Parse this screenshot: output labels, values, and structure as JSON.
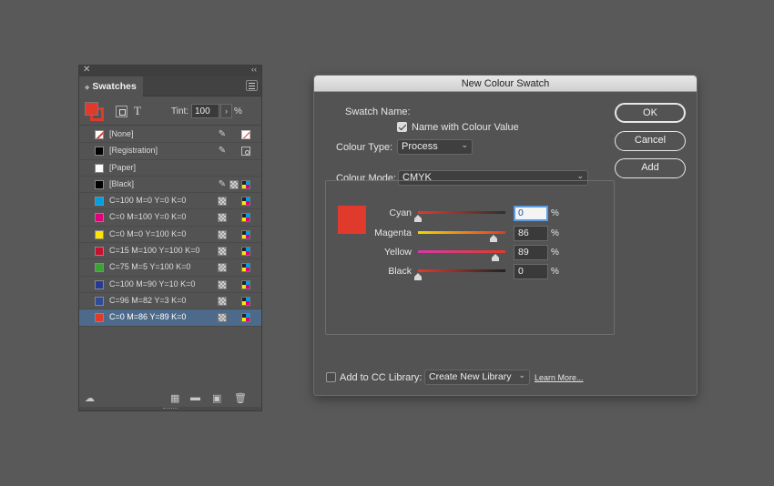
{
  "swatches_panel": {
    "close_glyph": "✕",
    "collapse_glyph": "‹‹",
    "tab_label": "Swatches",
    "tint_label": "Tint:",
    "tint_value": "100",
    "tint_unit": "%",
    "t_glyph": "T",
    "fill_color": "#e03a2c",
    "rows": [
      {
        "name": "[None]",
        "color": "none",
        "icons": [
          "pencil-x-icon",
          "none-icon"
        ]
      },
      {
        "name": "[Registration]",
        "color": "#000000",
        "icons": [
          "pencil-x-icon",
          "registration-mark-icon"
        ]
      },
      {
        "name": "[Paper]",
        "color": "#ffffff",
        "icons": []
      },
      {
        "name": "[Black]",
        "color": "#000000",
        "icons": [
          "pencil-x-icon",
          "process-grid-icon",
          "cmyk-icon"
        ]
      },
      {
        "name": "C=100 M=0 Y=0 K=0",
        "color": "#00a0e0",
        "icons": [
          "process-grid-icon",
          "cmyk-icon"
        ]
      },
      {
        "name": "C=0 M=100 Y=0 K=0",
        "color": "#e2007a",
        "icons": [
          "process-grid-icon",
          "cmyk-icon"
        ]
      },
      {
        "name": "C=0 M=0 Y=100 K=0",
        "color": "#ffe600",
        "icons": [
          "process-grid-icon",
          "cmyk-icon"
        ]
      },
      {
        "name": "C=15 M=100 Y=100 K=0",
        "color": "#c8102e",
        "icons": [
          "process-grid-icon",
          "cmyk-icon"
        ]
      },
      {
        "name": "C=75 M=5 Y=100 K=0",
        "color": "#3aa335",
        "icons": [
          "process-grid-icon",
          "cmyk-icon"
        ]
      },
      {
        "name": "C=100 M=90 Y=10 K=0",
        "color": "#263b8f",
        "icons": [
          "process-grid-icon",
          "cmyk-icon"
        ]
      },
      {
        "name": "C=96 M=82 Y=3 K=0",
        "color": "#2f4a96",
        "icons": [
          "process-grid-icon",
          "cmyk-icon"
        ]
      },
      {
        "name": "C=0 M=86 Y=89 K=0",
        "color": "#e03a2c",
        "icons": [
          "process-grid-icon",
          "cmyk-icon"
        ],
        "selected": true
      }
    ]
  },
  "dialog": {
    "title": "New Colour Swatch",
    "swatch_name_label": "Swatch Name:",
    "name_with_value_label": "Name with Colour Value",
    "name_with_value_checked": true,
    "colour_type_label": "Colour Type:",
    "colour_type_value": "Process",
    "colour_mode_label": "Colour Mode:",
    "colour_mode_value": "CMYK",
    "preview_color": "#e03a2c",
    "chevron_glyph": "⌄",
    "buttons": {
      "ok": "OK",
      "cancel": "Cancel",
      "add": "Add"
    },
    "sliders": [
      {
        "label": "Cyan",
        "value": "0",
        "unit": "%",
        "position": 0.0,
        "gradient": [
          "#e03a2c",
          "#303030"
        ]
      },
      {
        "label": "Magenta",
        "value": "86",
        "unit": "%",
        "position": 0.86,
        "gradient": [
          "#f2d600",
          "#e03a2c"
        ]
      },
      {
        "label": "Yellow",
        "value": "89",
        "unit": "%",
        "position": 0.89,
        "gradient": [
          "#d63aa4",
          "#e03a2c"
        ]
      },
      {
        "label": "Black",
        "value": "0",
        "unit": "%",
        "position": 0.0,
        "gradient": [
          "#e03a2c",
          "#222222"
        ]
      }
    ],
    "cc_library_label": "Add to CC Library:",
    "cc_library_checked": false,
    "cc_library_select": "Create New Library",
    "learn_more": "Learn More..."
  }
}
